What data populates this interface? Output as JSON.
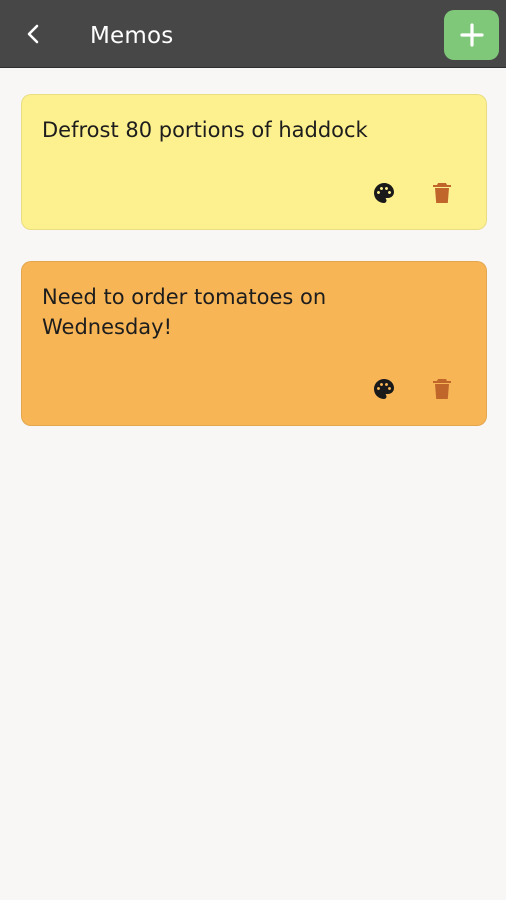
{
  "appbar": {
    "title": "Memos",
    "back_icon": "chevron-left-icon",
    "add_icon": "plus-icon",
    "bar_color": "#474747",
    "add_button_color": "#7fc879"
  },
  "memos": [
    {
      "text": "Defrost 80 portions of haddock",
      "color": "#fdf08e",
      "palette_icon": "palette-icon",
      "delete_icon": "trash-icon"
    },
    {
      "text": "Need to order tomatoes on Wednesday!",
      "color": "#f7b556",
      "palette_icon": "palette-icon",
      "delete_icon": "trash-icon"
    }
  ],
  "colors": {
    "background": "#f8f7f6",
    "delete_icon": "#c0662b",
    "palette_icon": "#1a1a1a"
  }
}
